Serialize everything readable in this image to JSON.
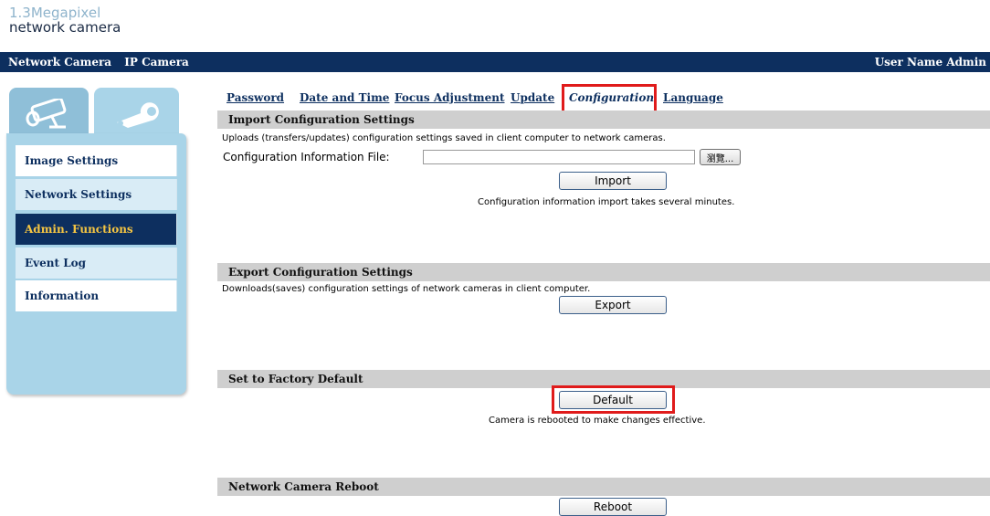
{
  "logo": {
    "line1": "1.3Megapixel",
    "line2": "network camera"
  },
  "topbar": {
    "network_camera": "Network Camera",
    "ip_camera": "IP Camera",
    "user": "User Name Admin"
  },
  "sidebar": {
    "tabs": [
      {
        "icon": "camera-icon"
      },
      {
        "icon": "wrench-icon"
      }
    ],
    "items": [
      {
        "label": "Image Settings"
      },
      {
        "label": "Network Settings"
      },
      {
        "label": "Admin. Functions"
      },
      {
        "label": "Event Log"
      },
      {
        "label": "Information"
      }
    ]
  },
  "tabs": {
    "password": "Password",
    "date_time": "Date and Time",
    "focus": "Focus Adjustment",
    "update": "Update",
    "configuration": "Configuration",
    "language": "Language"
  },
  "import": {
    "header": "Import Configuration Settings",
    "desc": "Uploads (transfers/updates) configuration settings saved in client computer to network cameras.",
    "file_label": "Configuration Information File:",
    "file_value": "",
    "browse_label": "瀏覽...",
    "button": "Import",
    "note": "Configuration information import takes several minutes."
  },
  "export": {
    "header": "Export Configuration Settings",
    "desc": "Downloads(saves) configuration settings of network cameras in client computer.",
    "button": "Export"
  },
  "factory": {
    "header": "Set to Factory Default",
    "button": "Default",
    "note": "Camera is rebooted to make changes effective."
  },
  "reboot": {
    "header": "Network Camera Reboot",
    "button": "Reboot"
  },
  "colors": {
    "navy": "#0d2f5f",
    "sidebar_blue": "#a9d4e8",
    "active_text": "#f5c542",
    "highlight_red": "#e01b1b",
    "section_gray": "#cfcfcf"
  }
}
